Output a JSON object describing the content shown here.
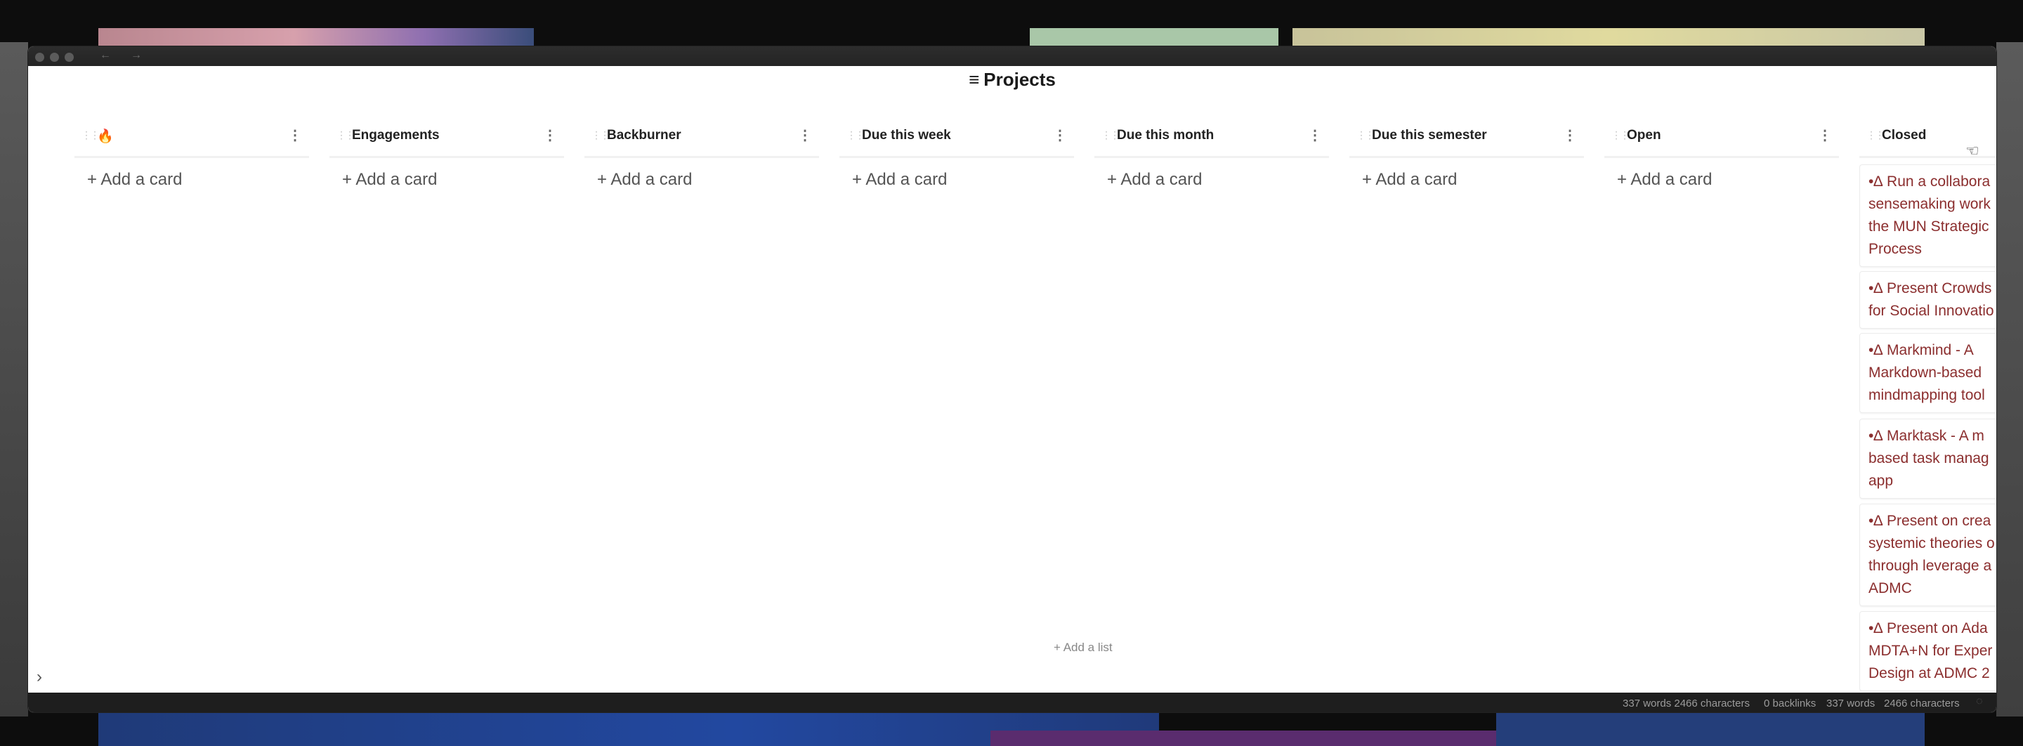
{
  "window": {
    "nav_back": "←",
    "nav_forward": "→"
  },
  "page": {
    "title_icon": "≡",
    "title": "Projects"
  },
  "lists": [
    {
      "title": "🔥",
      "add_card": "+ Add a card"
    },
    {
      "title": "Engagements",
      "add_card": "+ Add a card"
    },
    {
      "title": "Backburner",
      "add_card": "+ Add a card"
    },
    {
      "title": "Due this week",
      "add_card": "+ Add a card"
    },
    {
      "title": "Due this month",
      "add_card": "+ Add a card"
    },
    {
      "title": "Due this semester",
      "add_card": "+ Add a card"
    },
    {
      "title": "Open",
      "add_card": "+ Add a card"
    },
    {
      "title": "Closed",
      "cards": [
        [
          "•∆ Run a collabora",
          "sensemaking work",
          "the MUN Strategic",
          "Process"
        ],
        [
          "•∆ Present Crowds",
          "for Social Innovatio"
        ],
        [
          "•∆ Markmind - A",
          "Markdown-based",
          "mindmapping tool"
        ],
        [
          "•∆ Marktask - A m",
          "based task manag",
          "app"
        ],
        [
          "•∆ Present on crea",
          "systemic theories o",
          "through leverage a",
          "ADMC"
        ],
        [
          "•∆ Present on Ada",
          "MDTA+N for Exper",
          "Design at ADMC 2"
        ]
      ]
    }
  ],
  "board": {
    "add_list": "+ Add a list"
  },
  "statusbar": {
    "words_chars": "337 words 2466 characters",
    "backlinks": "0 backlinks",
    "words": "337 words",
    "characters": "2466 characters"
  },
  "icons": {
    "drag_handle": "drag-handle-icon",
    "list_menu": "kebab-menu-icon",
    "expand": "chevron-right-icon",
    "cursor": "hand-cursor-icon"
  },
  "colors": {
    "card_text": "#8b2e2e",
    "window_bg": "#ffffff",
    "statusbar_bg": "#1e1e1e"
  }
}
